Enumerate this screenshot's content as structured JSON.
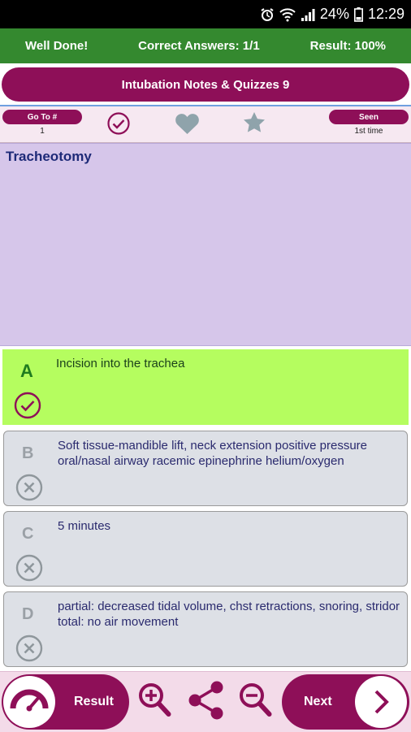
{
  "status": {
    "battery": "24%",
    "time": "12:29"
  },
  "resultbar": {
    "message": "Well Done!",
    "correct": "Correct Answers: 1/1",
    "result": "Result: 100%"
  },
  "title": "Intubation Notes & Quizzes 9",
  "toolbar": {
    "goto_label": "Go To #",
    "goto_value": "1",
    "seen_label": "Seen",
    "seen_value": "1st time"
  },
  "question": "Tracheotomy",
  "answers": [
    {
      "letter": "A",
      "text": "Incision into the trachea",
      "status": "correct"
    },
    {
      "letter": "B",
      "text": "Soft tissue-mandible lift, neck extension positive pressure oral/nasal airway racemic epinephrine helium/oxygen",
      "status": "wrong"
    },
    {
      "letter": "C",
      "text": "5 minutes",
      "status": "wrong"
    },
    {
      "letter": "D",
      "text": "partial: decreased tidal volume, chst retractions, snoring, stridor total: no air movement",
      "status": "wrong"
    }
  ],
  "bottom": {
    "result_label": "Result",
    "next_label": "Next"
  },
  "colors": {
    "primary": "#8e0f58",
    "green_bar": "#34892f",
    "correct_bg": "#b5fd5f",
    "question_bg": "#d6c6ea",
    "answer_bg": "#dde0e6"
  },
  "icons": [
    "alarm-icon",
    "wifi-icon",
    "signal-icon",
    "battery-icon",
    "checkmark-circle-icon",
    "heart-icon",
    "star-icon",
    "gauge-icon",
    "zoom-in-icon",
    "share-icon",
    "zoom-out-icon",
    "chevron-right-icon",
    "x-circle-icon"
  ]
}
